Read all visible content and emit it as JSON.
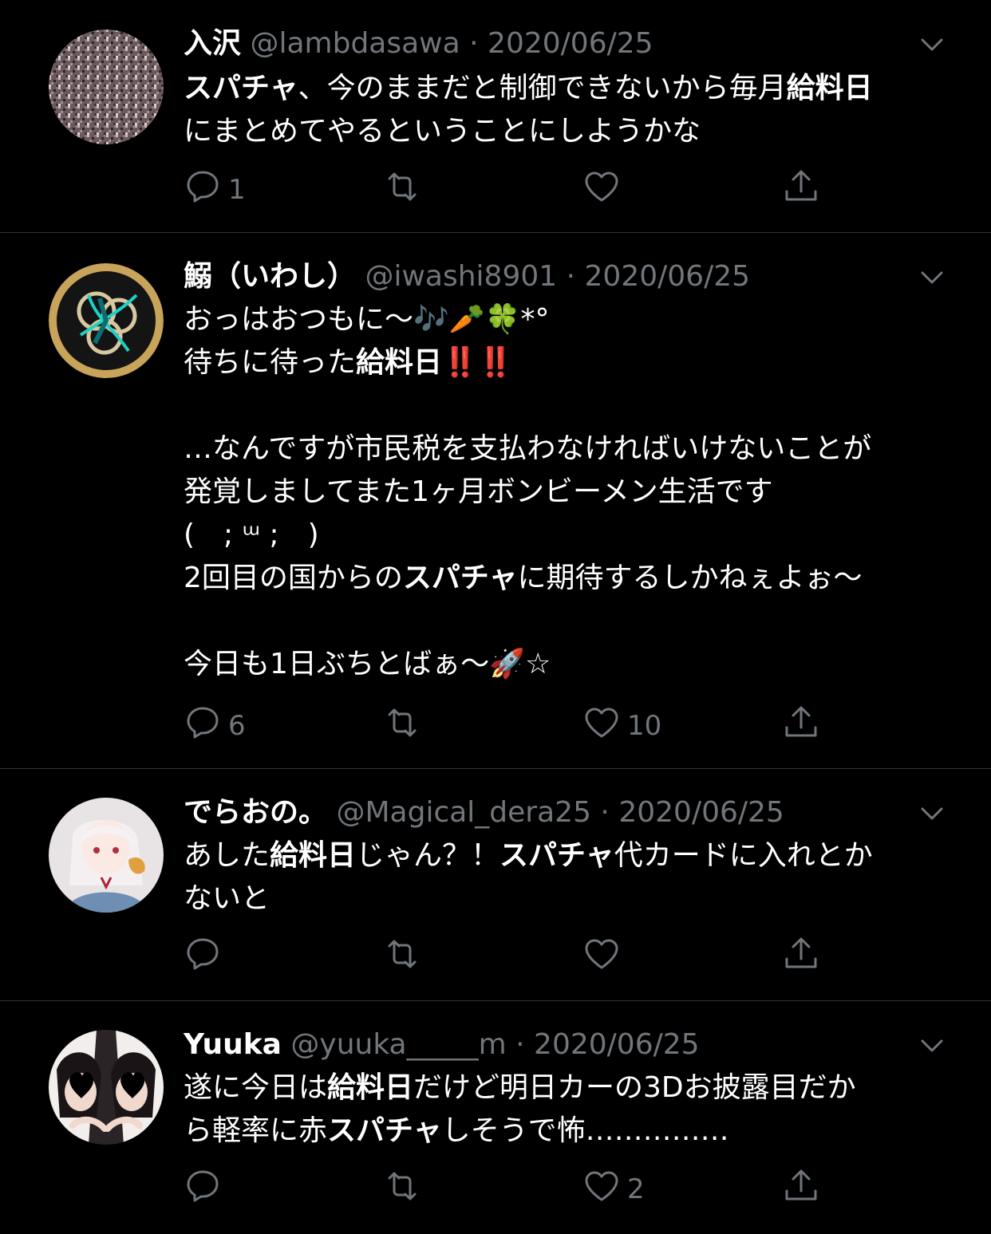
{
  "tweets": [
    {
      "name": "入沢",
      "handle": "@lambdasawa",
      "dot": "·",
      "date": "2020/06/25",
      "lines": [
        [
          {
            "t": "スパチャ",
            "b": true
          },
          {
            "t": "、今のままだと制御できないから毎月"
          },
          {
            "t": "給料日",
            "b": true
          }
        ],
        [
          {
            "t": "にまとめてやるということにしようかな"
          }
        ]
      ],
      "counts": {
        "reply": "1",
        "retweet": "",
        "like": "",
        "share": ""
      }
    },
    {
      "name": "鰯（いわし）",
      "handle": "@iwashi8901",
      "dot": "·",
      "date": "2020/06/25",
      "lines": [
        [
          {
            "t": "おっはおつもに〜🎶🥕🍀*°"
          }
        ],
        [
          {
            "t": "待ちに待った"
          },
          {
            "t": "給料日",
            "b": true
          },
          {
            "t": "‼️‼️",
            "red": true
          }
        ],
        [],
        [
          {
            "t": "…なんですが市民税を支払わなければいけないことが"
          }
        ],
        [
          {
            "t": "発覚しましてまた1ヶ月ボンビーメン生活です"
          }
        ],
        [
          {
            "t": "(　; ᵚ ;　)"
          }
        ],
        [
          {
            "t": "2回目の国からの"
          },
          {
            "t": "スパチャ",
            "b": true
          },
          {
            "t": "に期待するしかねぇよぉ〜"
          }
        ],
        [],
        [
          {
            "t": "今日も1日ぶちとばぁ〜🚀☆"
          }
        ]
      ],
      "counts": {
        "reply": "6",
        "retweet": "",
        "like": "10",
        "share": ""
      }
    },
    {
      "name": "でらおの。",
      "handle": "@Magical_dera25",
      "dot": "·",
      "date": "2020/06/25",
      "lines": [
        [
          {
            "t": "あした"
          },
          {
            "t": "給料日",
            "b": true
          },
          {
            "t": "じゃん？！"
          },
          {
            "t": "スパチャ",
            "b": true
          },
          {
            "t": "代カードに入れとか"
          }
        ],
        [
          {
            "t": "ないと"
          }
        ]
      ],
      "counts": {
        "reply": "",
        "retweet": "",
        "like": "",
        "share": ""
      }
    },
    {
      "name": "Yuuka",
      "handle": "@yuuka_____m",
      "dot": "·",
      "date": "2020/06/25",
      "lines": [
        [
          {
            "t": "遂に今日は"
          },
          {
            "t": "給料日",
            "b": true
          },
          {
            "t": "だけど明日カーの3Dお披露目だか"
          }
        ],
        [
          {
            "t": "ら軽率に赤"
          },
          {
            "t": "スパチャ",
            "b": true
          },
          {
            "t": "しそうで怖……………"
          }
        ]
      ],
      "counts": {
        "reply": "",
        "retweet": "",
        "like": "2",
        "share": ""
      }
    }
  ]
}
